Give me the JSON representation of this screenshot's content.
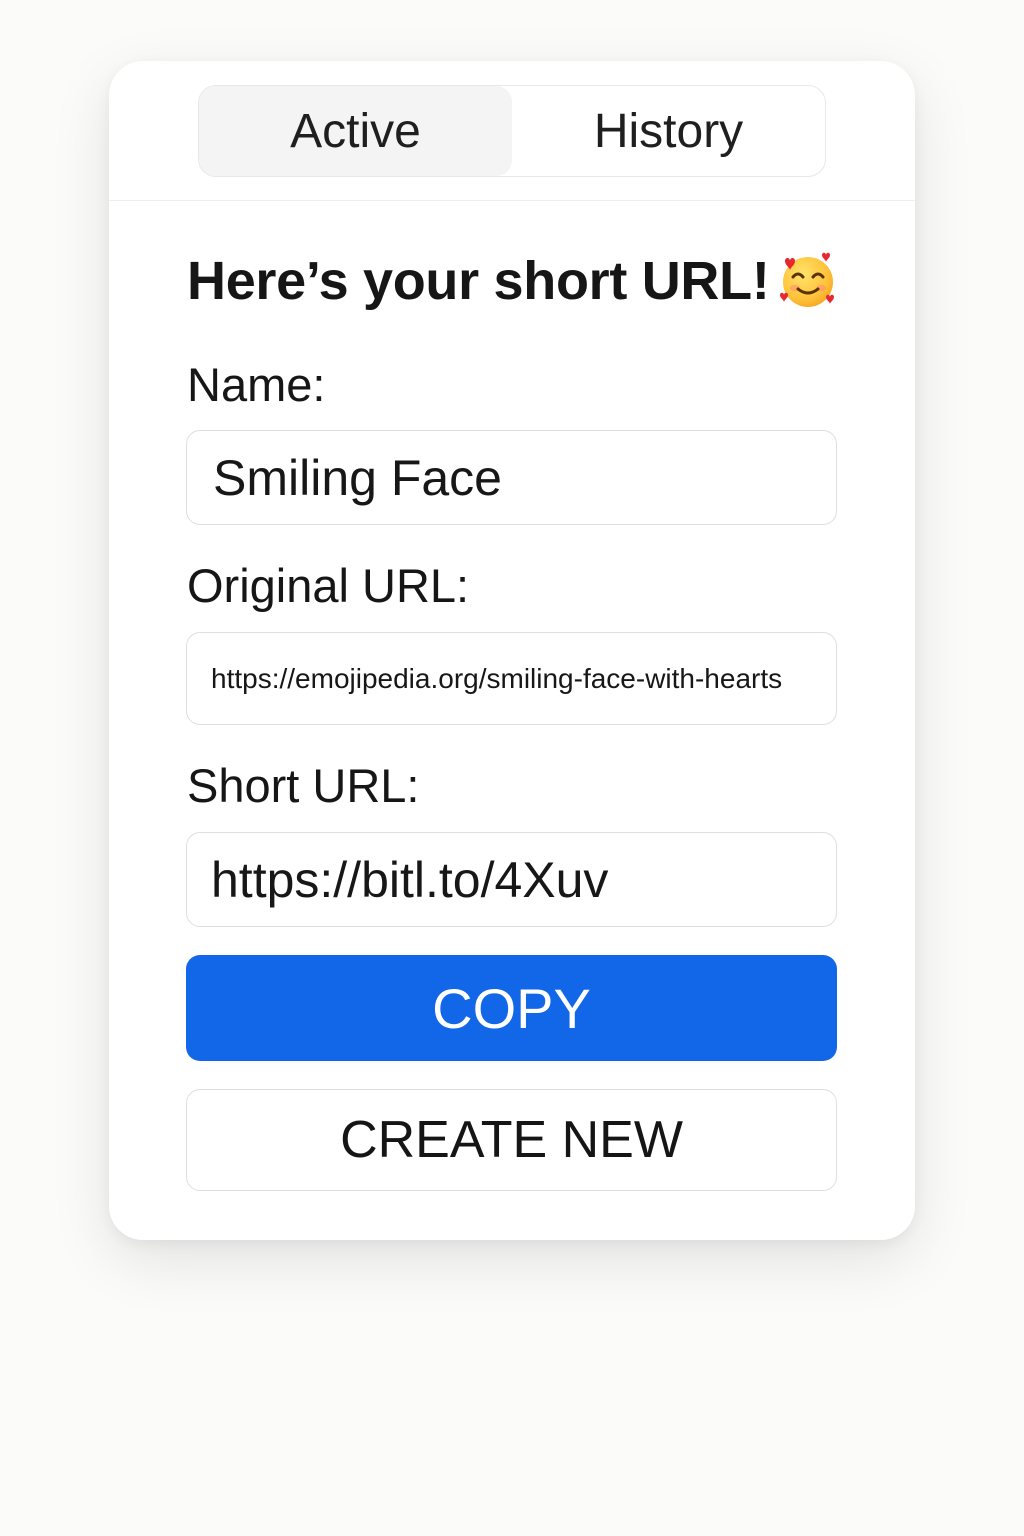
{
  "tabs": [
    {
      "label": "Active",
      "active": true
    },
    {
      "label": "History",
      "active": false
    }
  ],
  "heading": {
    "text": "Here’s your short URL!",
    "emoji_icon": "smiling-face-with-hearts-icon"
  },
  "form": {
    "name_label": "Name:",
    "name_value": "Smiling Face",
    "original_label": "Original URL:",
    "original_value": "https://emojipedia.org/smiling-face-with-hearts",
    "short_label": "Short URL:",
    "short_value": "https://bitl.to/4Xuv"
  },
  "actions": {
    "copy_label": "COPY",
    "create_label": "CREATE NEW"
  },
  "colors": {
    "accent": "#1267e8",
    "background": "#fbfbfa",
    "card": "#ffffff",
    "border": "#dedede"
  }
}
